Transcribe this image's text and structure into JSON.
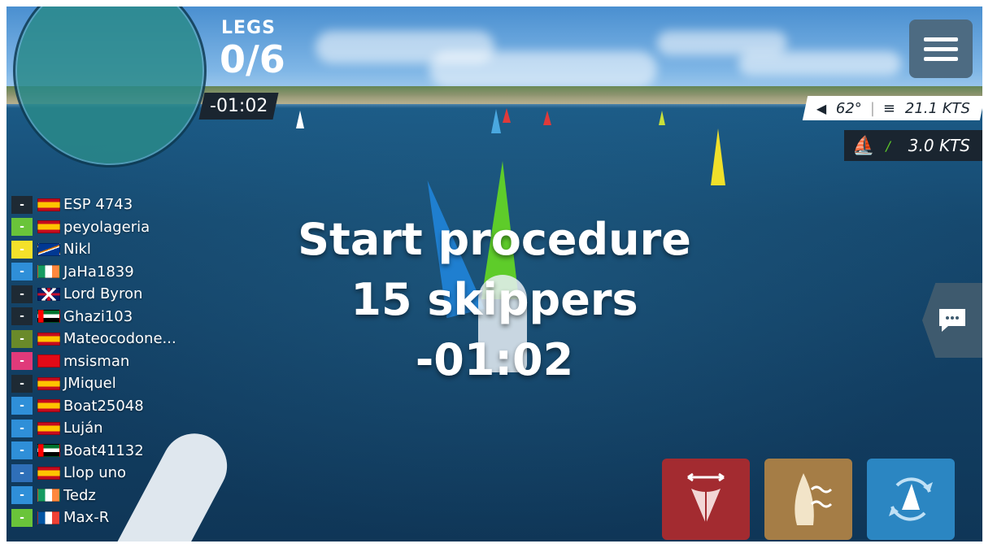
{
  "hud": {
    "legs_label": "LEGS",
    "legs_value": "0/6",
    "countdown": "-01:02"
  },
  "wind": {
    "angle": "62°",
    "speed": "21.1 KTS"
  },
  "boat_speed": "3.0 KTS",
  "overlay": {
    "title": "Start procedure",
    "skippers": "15 skippers",
    "countdown": "-01:02"
  },
  "ranking": [
    {
      "name": "ESP 4743",
      "color": "#1e2a34",
      "flag": "es"
    },
    {
      "name": "peyolageria",
      "color": "#6ac43a",
      "flag": "es"
    },
    {
      "name": "Nikl",
      "color": "#f4e12a",
      "flag": "mh"
    },
    {
      "name": "JaHa1839",
      "color": "#2f8fd8",
      "flag": "ie"
    },
    {
      "name": "Lord Byron",
      "color": "#1e2a34",
      "flag": "gb"
    },
    {
      "name": "Ghazi103",
      "color": "#1e2a34",
      "flag": "ae"
    },
    {
      "name": "Mateocodone...",
      "color": "#6a8a2a",
      "flag": "es"
    },
    {
      "name": "msisman",
      "color": "#e03a7a",
      "flag": "tr"
    },
    {
      "name": "JMiquel",
      "color": "#1e2a34",
      "flag": "es"
    },
    {
      "name": "Boat25048",
      "color": "#2f8fd8",
      "flag": "es"
    },
    {
      "name": "Luján",
      "color": "#2f8fd8",
      "flag": "es"
    },
    {
      "name": "Boat41132",
      "color": "#2f8fd8",
      "flag": "ae"
    },
    {
      "name": "Llop uno",
      "color": "#2f6fb8",
      "flag": "es"
    },
    {
      "name": "Tedz",
      "color": "#2f8fd8",
      "flag": "ie"
    },
    {
      "name": "Max-R",
      "color": "#6ac43a",
      "flag": "fr"
    }
  ],
  "colors": {
    "btn_red": "#a32b30",
    "btn_tan": "#a57d46",
    "btn_blue": "#2b86c2"
  },
  "icons": {
    "menu": "hamburger-icon",
    "wind_direction": "wind-vane-icon",
    "wind_speed": "wind-icon",
    "boat_speed": "sailboat-icon",
    "chat": "chat-bubble-icon",
    "sail_trim": "sail-trim-icon",
    "sail_change": "sail-waves-icon",
    "tack": "tack-rotate-icon"
  }
}
